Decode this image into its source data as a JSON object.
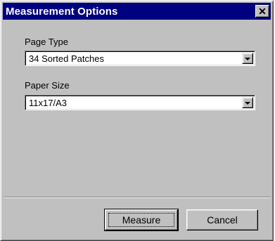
{
  "window": {
    "title": "Measurement Options",
    "close_label": "✕"
  },
  "page_type": {
    "label": "Page Type",
    "value": "34 Sorted Patches"
  },
  "paper_size": {
    "label": "Paper Size",
    "value": "11x17/A3"
  },
  "buttons": {
    "measure": "Measure",
    "cancel": "Cancel"
  },
  "colors": {
    "titlebar": "#000080",
    "face": "#c0c0c0"
  }
}
